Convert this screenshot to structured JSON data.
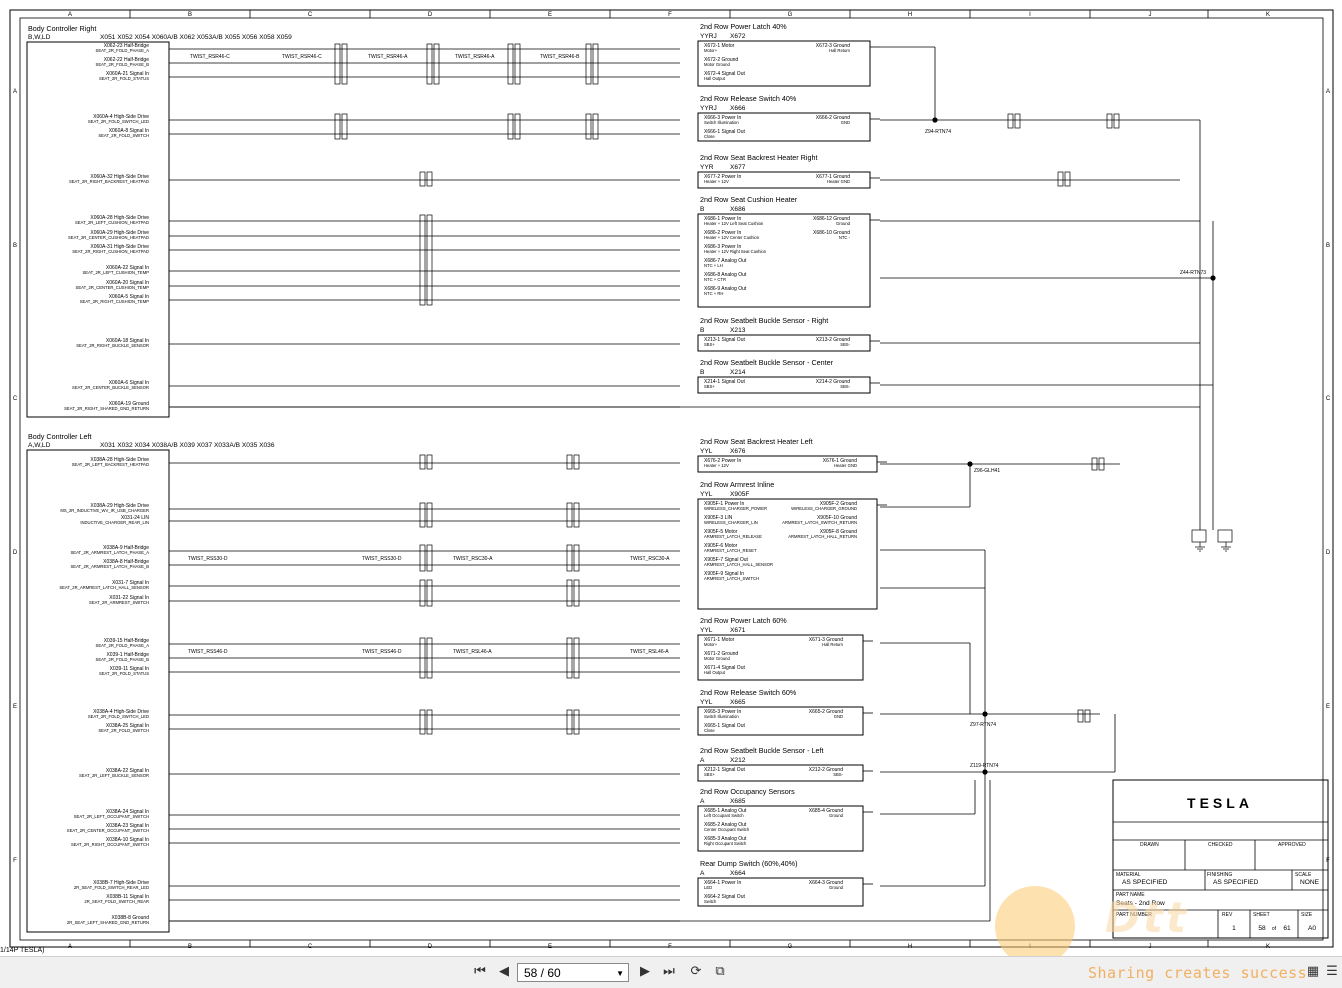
{
  "zone_cols": [
    "A",
    "B",
    "C",
    "D",
    "E",
    "F",
    "G",
    "H",
    "I",
    "J",
    "K"
  ],
  "zone_rows": [
    "A",
    "B",
    "C",
    "D",
    "E",
    "F"
  ],
  "controllers": {
    "right": {
      "title": "Body Controller Right",
      "sub": "B,W,LD",
      "connectors": "X051   X052   X054   X060A/B   X062   X053A/B   X055   X056   X058   X059"
    },
    "left": {
      "title": "Body Controller Left",
      "sub": "A,W,LD",
      "connectors": "X031   X032     X034   X038A/B   X039   X037   X033A/B   X035   X036"
    }
  },
  "right_pins": [
    {
      "a": "X062-23 Half-Bridge",
      "b": "SEAT_2R_FOLD_PHASE_A"
    },
    {
      "a": "X062-22 Half-Bridge",
      "b": "SEAT_2R_FOLD_PHASE_B"
    },
    {
      "a": "X060A-21 Signal In",
      "b": "SEAT_2R_FOLD_STATUS"
    },
    {
      "a": "X060A-4 High-Side Drive",
      "b": "SEAT_2R_FOLD_SWITCH_LED"
    },
    {
      "a": "X060A-8 Signal In",
      "b": "SEAT_2R_FOLD_SWITCH"
    },
    {
      "a": "X060A-32 High-Side Drive",
      "b": "SEAT_2R_RIGHT_BACKREST_HEATPAD"
    },
    {
      "a": "X060A-28 High-Side Drive",
      "b": "SEAT_2R_LEFT_CUSHION_HEATPAD"
    },
    {
      "a": "X060A-29 High-Side Drive",
      "b": "SEAT_2R_CENTER_CUSHION_HEATPAD"
    },
    {
      "a": "X060A-31 High-Side Drive",
      "b": "SEAT_2R_RIGHT_CUSHION_HEATPAD"
    },
    {
      "a": "X060A-22 Signal In",
      "b": "SEAT_2R_LEFT_CUSHION_TEMP"
    },
    {
      "a": "X060A-20 Signal In",
      "b": "SEAT_2R_CENTER_CUSHION_TEMP"
    },
    {
      "a": "X060A-5 Signal In",
      "b": "SEAT_2R_RIGHT_CUSHION_TEMP"
    },
    {
      "a": "X060A-18 Signal In",
      "b": "SEAT_2R_RIGHT_BUCKLE_SENSOR"
    },
    {
      "a": "X060A-6 Signal In",
      "b": "SEAT_2R_CENTER_BUCKLE_SENSOR"
    },
    {
      "a": "X060A-19 Ground",
      "b": "SEAT_2R_RIGHT_SHARED_GND_RETURN"
    }
  ],
  "left_pins": [
    {
      "a": "X038A-28 High-Side Drive",
      "b": "SEAT_2R_LEFT_BACKREST_HEATPAD"
    },
    {
      "a": "X038A-29 High-Side Drive",
      "b": "MS_2R_INDUCTIVE_WV_IR_USB_CHARGER"
    },
    {
      "a": "X031-24 LIN",
      "b": "INDUCTIVE_CHARGER_REAR_LIN"
    },
    {
      "a": "X038A-9 Half-Bridge",
      "b": "SEAT_2R_ARMREST_LATCH_PHASE_A"
    },
    {
      "a": "X038A-8 Half-Bridge",
      "b": "SEAT_2R_ARMREST_LATCH_PHASE_B"
    },
    {
      "a": "X031-7 Signal In",
      "b": "SEAT_2R_ARMREST_LATCH_HALL_SENSOR"
    },
    {
      "a": "X031-22 Signal In",
      "b": "SEAT_2R_ARMREST_SWITCH"
    },
    {
      "a": "X039-15 Half-Bridge",
      "b": "SEAT_2R_FOLD_PHASE_A"
    },
    {
      "a": "X039-1 Half-Bridge",
      "b": "SEAT_2R_FOLD_PHASE_B"
    },
    {
      "a": "X039-11 Signal In",
      "b": "SEAT_2R_FOLD_STATUS"
    },
    {
      "a": "X038A-4 High-Side Drive",
      "b": "SEAT_2R_FOLD_SWITCH_LED"
    },
    {
      "a": "X038A-25 Signal In",
      "b": "SEAT_2R_FOLD_SWITCH"
    },
    {
      "a": "X038A-22 Signal In",
      "b": "SEAT_2R_LEFT_BUCKLE_SENSOR"
    },
    {
      "a": "X038A-24 Signal In",
      "b": "SEAT_2R_LEFT_OCCUPANT_SWITCH"
    },
    {
      "a": "X038A-23 Signal In",
      "b": "SEAT_2R_CENTER_OCCUPANT_SWITCH"
    },
    {
      "a": "X038A-10 Signal In",
      "b": "SEAT_2R_RIGHT_OCCUPANT_SWITCH"
    },
    {
      "a": "X038B-7 High-Side Drive",
      "b": "2R_SEAT_FOLD_SWITCH_REAR_LED"
    },
    {
      "a": "X038B-11 Signal In",
      "b": "2R_SEAT_FOLD_SWITCH_REAR"
    },
    {
      "a": "X038B-8 Ground",
      "b": "2R_SEAT_LEFT_SHARED_GND_RETURN"
    }
  ],
  "components": [
    {
      "title": "2nd Row Power Latch 40%",
      "code": "YYRJ",
      "id": "X672",
      "left_pins": [
        "X672-1 Motor",
        "Motor+",
        "X672-2 Ground",
        "Motor Ground",
        "X672-4 Signal Out",
        "Hall Output"
      ],
      "right_pins": [
        "X672-3 Ground",
        "Hall Return"
      ]
    },
    {
      "title": "2nd Row Release Switch 40%",
      "code": "YYRJ",
      "id": "X666",
      "left_pins": [
        "X666-3 Power In",
        "Switch Illumination",
        "X666-1 Signal Out",
        "Close"
      ],
      "right_pins": [
        "X666-2 Ground",
        "GND"
      ]
    },
    {
      "title": "2nd Row Seat Backrest Heater Right",
      "code": "YYR",
      "id": "X677",
      "left_pins": [
        "X677-2 Power In",
        "Heater + 12V"
      ],
      "right_pins": [
        "X677-1 Ground",
        "Heater GND"
      ]
    },
    {
      "title": "2nd Row Seat Cushion Heater",
      "code": "B",
      "id": "X686",
      "left_pins": [
        "X686-1 Power In",
        "Heater + 12V Left Seat Cushion",
        "X686-2 Power In",
        "Heater + 12V Center Cushion",
        "X686-3 Power In",
        "Heater + 12V Right Seat Cushion",
        "X686-7 Analog Out",
        "NTC + LH",
        "X686-8 Analog Out",
        "NTC + CTR",
        "X686-9 Analog Out",
        "NTC + RH"
      ],
      "right_pins": [
        "X686-12 Ground",
        "Ground",
        "X686-10 Ground",
        "NTC -"
      ]
    },
    {
      "title": "2nd Row Seatbelt Buckle Sensor - Right",
      "code": "B",
      "id": "X213",
      "left_pins": [
        "X213-1 Signal Out",
        "SBS+"
      ],
      "right_pins": [
        "X213-2 Ground",
        "SBS-"
      ]
    },
    {
      "title": "2nd Row Seatbelt Buckle Sensor - Center",
      "code": "B",
      "id": "X214",
      "left_pins": [
        "X214-1 Signal Out",
        "SBS+"
      ],
      "right_pins": [
        "X214-2 Ground",
        "SBS-"
      ]
    },
    {
      "title": "2nd Row Seat Backrest Heater Left",
      "code": "YYL",
      "id": "X676",
      "left_pins": [
        "X676-2 Power In",
        "Heater + 12V"
      ],
      "right_pins": [
        "X676-1 Ground",
        "Heater GND"
      ]
    },
    {
      "title": "2nd Row Armrest Inline",
      "code": "YYL",
      "id": "X905F",
      "left_pins": [
        "X905F-1 Power In",
        "WIRELESS_CHARGER_POWER",
        "X905F-3 LIN",
        "WIRELESS_CHARGER_LIN",
        "X905F-5 Motor",
        "ARMREST_LATCH_RELEASE",
        "X905F-6 Motor",
        "ARMREST_LATCH_RESET",
        "X905F-7 Signal Out",
        "ARMREST_LATCH_HALL_SENSOR",
        "X905F-9 Signal In",
        "ARMREST_LATCH_SWITCH"
      ],
      "right_pins": [
        "X905F-2 Ground",
        "WIRELESS_CHARGER_GROUND",
        "X905F-10 Ground",
        "ARMREST_LATCH_SWITCH_RETURN",
        "X905F-8 Ground",
        "ARMREST_LATCH_HALL_RETURN"
      ]
    },
    {
      "title": "2nd Row Power Latch 60%",
      "code": "YYL",
      "id": "X671",
      "left_pins": [
        "X671-1 Motor",
        "Motor+",
        "X671-2 Ground",
        "Motor Ground",
        "X671-4 Signal Out",
        "Hall Output"
      ],
      "right_pins": [
        "X671-3 Ground",
        "Hall Return"
      ]
    },
    {
      "title": "2nd Row Release Switch 60%",
      "code": "YYL",
      "id": "X665",
      "left_pins": [
        "X665-3 Power In",
        "Switch Illumination",
        "X665-1 Signal Out",
        "Close"
      ],
      "right_pins": [
        "X665-2 Ground",
        "GND"
      ]
    },
    {
      "title": "2nd Row Seatbelt Buckle Sensor - Left",
      "code": "A",
      "id": "X212",
      "left_pins": [
        "X212-1 Signal Out",
        "SBS+"
      ],
      "right_pins": [
        "X212-2 Ground",
        "SBS-"
      ]
    },
    {
      "title": "2nd Row Occupancy Sensors",
      "code": "A",
      "id": "X685",
      "left_pins": [
        "X685-1 Analog Out",
        "Left Occupant Switch",
        "X685-2 Analog Out",
        "Center Occupant Switch",
        "X685-3 Analog Out",
        "Right Occupant Switch"
      ],
      "right_pins": [
        "X685-4 Ground",
        "Ground"
      ]
    },
    {
      "title": "Rear Dump Switch (60%,40%)",
      "code": "A",
      "id": "X664",
      "left_pins": [
        "X664-1 Power In",
        "LED",
        "X664-2 Signal Out",
        "Switch"
      ],
      "right_pins": [
        "X664-3 Ground",
        "Ground"
      ]
    }
  ],
  "twists": {
    "r1": "TWIST_RSR46-C",
    "r2": "TWIST_RSR46-C",
    "r3": "TWIST_RSR46-A",
    "r4": "TWIST_RSR46-A",
    "r5": "TWIST_RSR46-B",
    "l1": "TWIST_RSS30-D",
    "l2": "TWIST_RSS30-D",
    "l3": "TWIST_RSC30-A",
    "l4": "TWIST_RSC30-A",
    "l5": "TWIST_RSS46-D",
    "l6": "TWIST_RSS46-D",
    "l7": "TWIST_RSL46-A",
    "l8": "TWIST_RSL46-A"
  },
  "splices": {
    "s1": "Z94-RTN74",
    "s2": "Z44-RTN73",
    "s3": "Z96-GLH41",
    "s4": "Z97-RTN74",
    "s5": "Z119-RTN74"
  },
  "title_block": {
    "logo": "TESLA",
    "drawn": "DRAWN",
    "checked": "CHECKED",
    "approved": "APPROVED",
    "material_label": "MATERIAL",
    "material": "AS SPECIFIED",
    "finishing_label": "FINISHING",
    "finishing": "AS SPECIFIED",
    "scale_label": "SCALE",
    "scale": "NONE",
    "part_name_label": "PART NAME",
    "part_name": "Seats - 2nd Row",
    "part_number_label": "PART NUMBER",
    "rev_label": "REV",
    "rev": "1",
    "sheet_label": "SHEET",
    "sheet": "58",
    "sheet_of": "of",
    "sheet_total": "61",
    "size_label": "SIZE",
    "size": "A0"
  },
  "footer_left": "1/14P TESLA)",
  "viewer": {
    "page_value": "58 / 60",
    "first_icon": "first-page-icon",
    "prev_icon": "prev-page-icon",
    "next_icon": "next-page-icon",
    "last_icon": "last-page-icon"
  },
  "watermark": {
    "text": "Sharing creates success",
    "logo_text": "Dtt"
  }
}
